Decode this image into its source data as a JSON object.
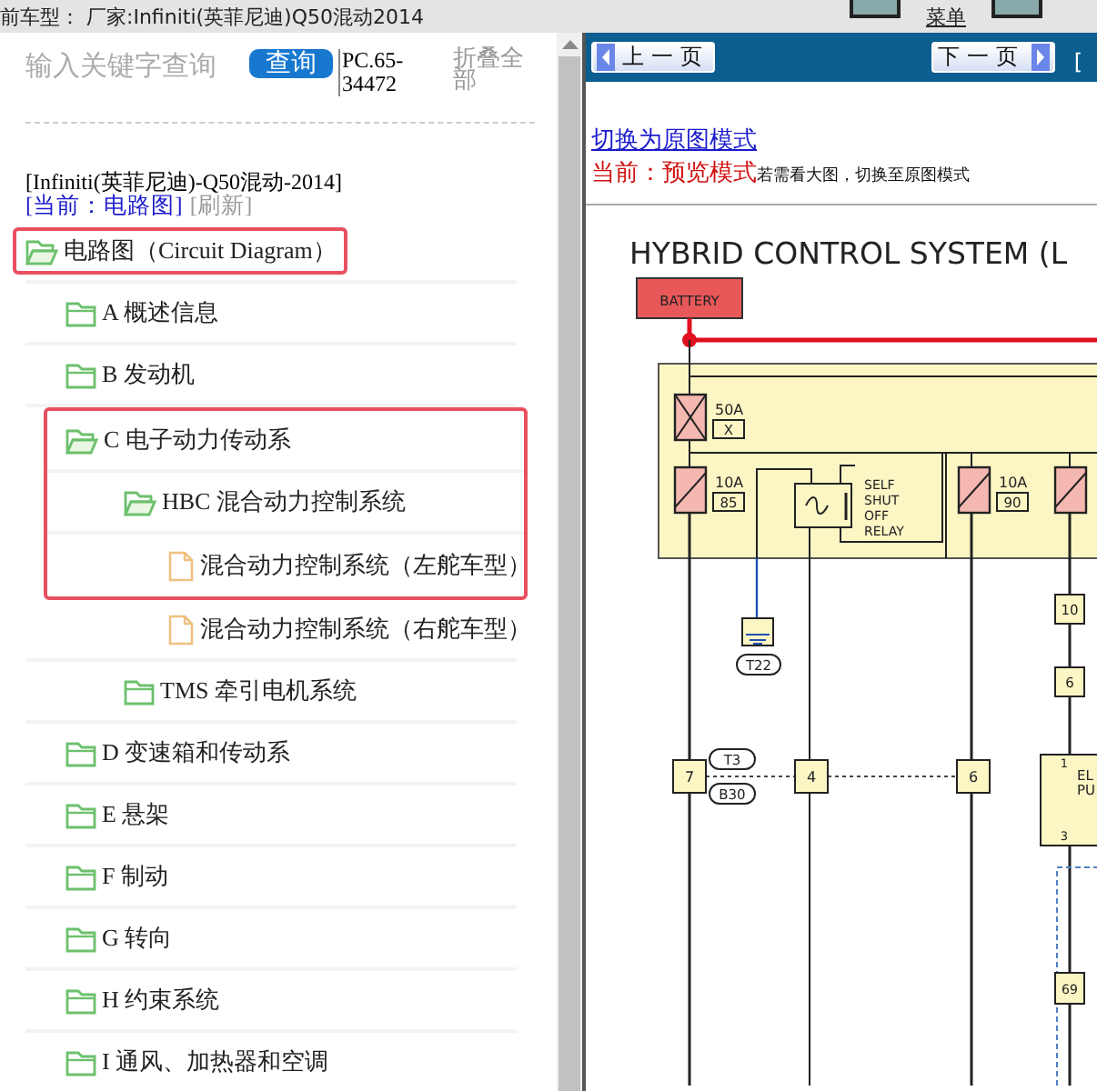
{
  "top_bar": {
    "vehicle": "前车型： 厂家:Infiniti(英菲尼迪)Q50混动2014",
    "menu_label": "菜单"
  },
  "search": {
    "placeholder": "输入关键字查询",
    "button": "查询"
  },
  "code": "PC.65-34472",
  "collapse_all": "折叠全部",
  "model_line": "[Infiniti(英菲尼迪)-Q50混动-2014]",
  "current": "[当前：电路图]",
  "refresh": "[刷新]",
  "tree": [
    {
      "label": "电路图（Circuit Diagram）",
      "kind": "folder",
      "expanded": true,
      "highlighted": true,
      "children": [
        {
          "label": "A 概述信息",
          "kind": "folder",
          "expanded": false,
          "highlighted": false
        },
        {
          "label": "B 发动机",
          "kind": "folder",
          "expanded": false,
          "highlighted": false
        },
        {
          "label": "C 电子动力传动系",
          "kind": "folder",
          "expanded": true,
          "highlighted": true,
          "children": [
            {
              "label": "HBC 混合动力控制系统",
              "kind": "folder",
              "expanded": true,
              "highlighted": true,
              "children": [
                {
                  "label": "混合动力控制系统（左舵车型）",
                  "kind": "file",
                  "highlighted": true
                },
                {
                  "label": "混合动力控制系统（右舵车型）",
                  "kind": "file",
                  "highlighted": false
                }
              ]
            },
            {
              "label": "TMS 牵引电机系统",
              "kind": "folder",
              "expanded": false,
              "highlighted": false
            }
          ]
        },
        {
          "label": "D 变速箱和传动系",
          "kind": "folder",
          "expanded": false,
          "highlighted": false
        },
        {
          "label": "E 悬架",
          "kind": "folder",
          "expanded": false,
          "highlighted": false
        },
        {
          "label": "F 制动",
          "kind": "folder",
          "expanded": false,
          "highlighted": false
        },
        {
          "label": "G 转向",
          "kind": "folder",
          "expanded": false,
          "highlighted": false
        },
        {
          "label": "H 约束系统",
          "kind": "folder",
          "expanded": false,
          "highlighted": false
        },
        {
          "label": "I 通风、加热器和空调",
          "kind": "folder",
          "expanded": false,
          "highlighted": false
        }
      ]
    }
  ],
  "viewer": {
    "prev": "上一页",
    "next": "下一页",
    "cut_link": "[",
    "mode_link": "切换为原图模式",
    "mode_label": "当前：预览模式",
    "mode_hint": "若需看大图，切换至原图模式",
    "diagram": {
      "title": "HYBRID CONTROL SYSTEM (L",
      "battery": "BATTERY",
      "fuses": [
        {
          "rating": "50A",
          "code": "X"
        },
        {
          "rating": "10A",
          "code": "85"
        },
        {
          "rating": "10A",
          "code": "90"
        }
      ],
      "relay": [
        "SELF",
        "SHUT",
        "OFF",
        "RELAY"
      ],
      "ground": "T22",
      "connectors": [
        "7",
        "4",
        "6"
      ],
      "harness": [
        "T3",
        "B30"
      ],
      "side_connectors": [
        "10",
        "6"
      ],
      "component": {
        "name": [
          "EL",
          "PU"
        ],
        "pins": [
          "1",
          "3"
        ]
      },
      "terminal": "69"
    }
  }
}
